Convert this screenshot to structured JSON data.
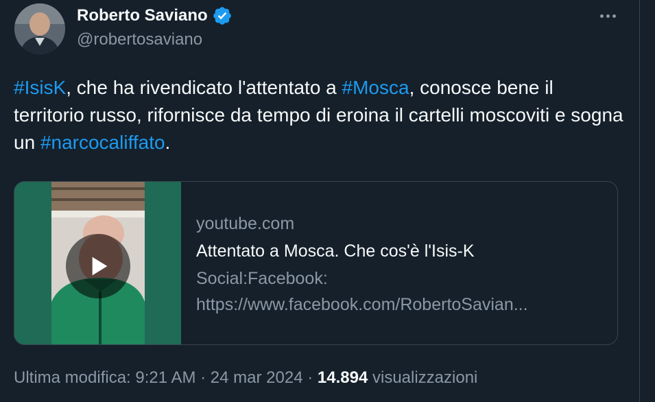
{
  "author": {
    "display_name": "Roberto Saviano",
    "handle": "@robertosaviano",
    "verified_icon": "verified-badge-icon"
  },
  "more_icon": "more-horizontal-icon",
  "tweet": {
    "segments": [
      {
        "type": "hashtag",
        "text": "#IsisK"
      },
      {
        "type": "text",
        "text": ", che ha rivendicato l'attentato a "
      },
      {
        "type": "hashtag",
        "text": "#Mosca"
      },
      {
        "type": "text",
        "text": ", conosce bene il territorio russo, rifornisce da tempo di eroina il cartelli moscoviti e sogna un "
      },
      {
        "type": "hashtag",
        "text": "#narcocaliffato"
      },
      {
        "type": "text",
        "text": "."
      }
    ]
  },
  "card": {
    "domain": "youtube.com",
    "title": "Attentato a Mosca. Che cos'è l'Isis-K",
    "description_line1": "Social:Facebook:",
    "description_line2": "https://www.facebook.com/RobertoSavian...",
    "play_icon": "play-icon"
  },
  "meta": {
    "label": "Ultima modifica:",
    "time": "9:21 AM",
    "separator": "·",
    "date": "24 mar 2024",
    "views_count": "14.894",
    "views_label": "visualizzazioni"
  },
  "colors": {
    "background": "#15202b",
    "text_primary": "#f7f9f9",
    "text_secondary": "#8b98a5",
    "link": "#1d9bf0",
    "border": "#38444d",
    "verified": "#1d9bf0"
  }
}
